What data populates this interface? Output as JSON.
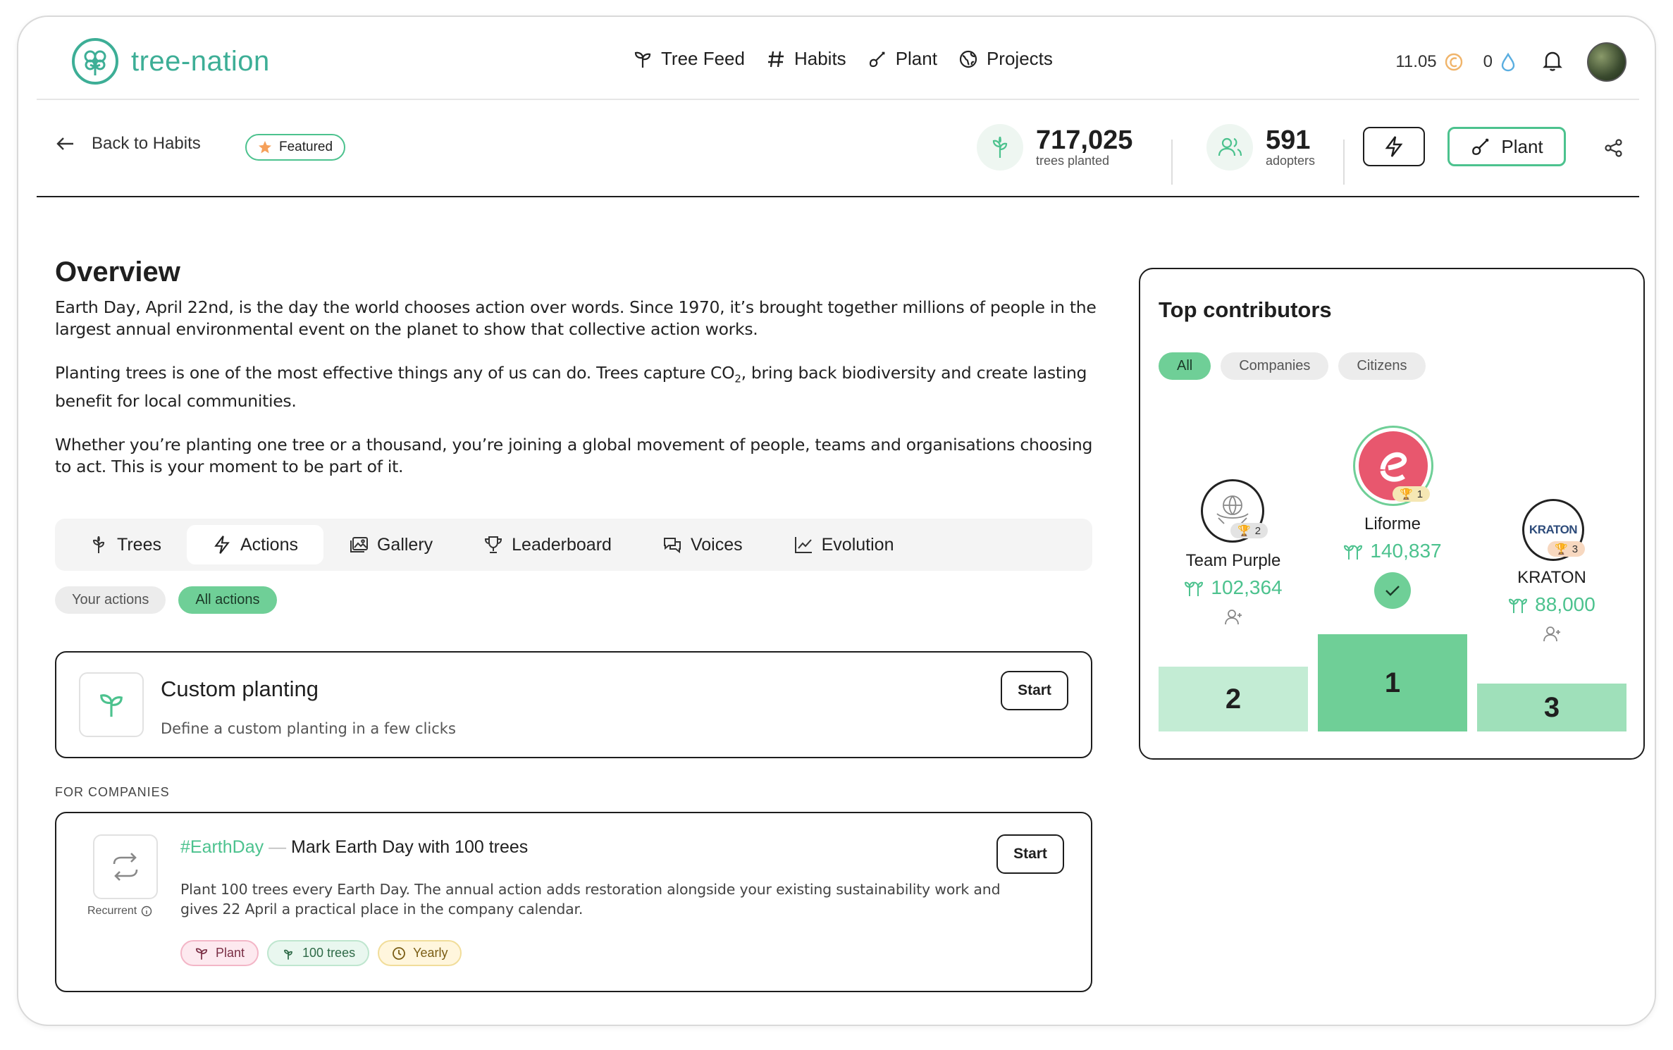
{
  "brand": {
    "name": "tree-nation",
    "accent": "#3dae96",
    "green": "#4cc28e"
  },
  "nav": {
    "links": [
      {
        "label": "Tree Feed",
        "icon": "sprout-icon"
      },
      {
        "label": "Habits",
        "icon": "hash-icon"
      },
      {
        "label": "Plant",
        "icon": "shovel-icon"
      },
      {
        "label": "Projects",
        "icon": "globe-icon"
      }
    ],
    "coins": "11.05",
    "drops": "0"
  },
  "subheader": {
    "back_label": "Back to Habits",
    "featured_label": "Featured",
    "trees_planted_value": "717,025",
    "trees_planted_label": "trees planted",
    "adopters_value": "591",
    "adopters_label": "adopters",
    "plant_button": "Plant"
  },
  "overview": {
    "title": "Overview",
    "p1": "Earth Day, April 22nd, is the day the world chooses action over words. Since 1970, it’s brought together millions of people in the largest annual environmental event on the planet to show that collective action works.",
    "p2_a": "Planting trees is one of the most effective things any of us can do. Trees capture CO",
    "p2_sub": "2",
    "p2_b": ", bring back biodiversity and create lasting benefit for local communities.",
    "p3": "Whether you’re planting one tree or a thousand, you’re joining a global movement of people, teams and organisations choosing to act. This is your moment to be part of it."
  },
  "tabs": [
    {
      "label": "Trees",
      "icon": "tree-icon"
    },
    {
      "label": "Actions",
      "icon": "bolt-icon"
    },
    {
      "label": "Gallery",
      "icon": "gallery-icon"
    },
    {
      "label": "Leaderboard",
      "icon": "trophy-icon"
    },
    {
      "label": "Voices",
      "icon": "chat-icon"
    },
    {
      "label": "Evolution",
      "icon": "chart-icon"
    }
  ],
  "active_tab": "Actions",
  "action_filters": {
    "yours": "Your actions",
    "all": "All actions"
  },
  "custom_planting": {
    "title": "Custom planting",
    "subtitle": "Define a custom planting in a few clicks",
    "start": "Start"
  },
  "for_companies": {
    "heading": "FOR COMPANIES",
    "hashtag": "#EarthDay",
    "separator": "—",
    "title": "Mark Earth Day with 100 trees",
    "description": "Plant 100 trees every Earth Day. The annual action adds restoration alongside your existing sustainability work and gives 22 April a practical place in the company calendar.",
    "recurrent_label": "Recurrent",
    "start": "Start",
    "chips": {
      "plant": "Plant",
      "trees": "100 trees",
      "frequency": "Yearly"
    }
  },
  "contributors": {
    "title": "Top contributors",
    "filters": [
      "All",
      "Companies",
      "Citizens"
    ],
    "first": {
      "name": "Liforme",
      "trees": "140,837",
      "rank": "1",
      "badge": "1"
    },
    "second": {
      "name": "Team Purple",
      "trees": "102,364",
      "rank": "2",
      "badge": "2"
    },
    "third": {
      "name": "KRATON",
      "logo_text": "KRATON",
      "trees": "88,000",
      "rank": "3",
      "badge": "3"
    }
  }
}
